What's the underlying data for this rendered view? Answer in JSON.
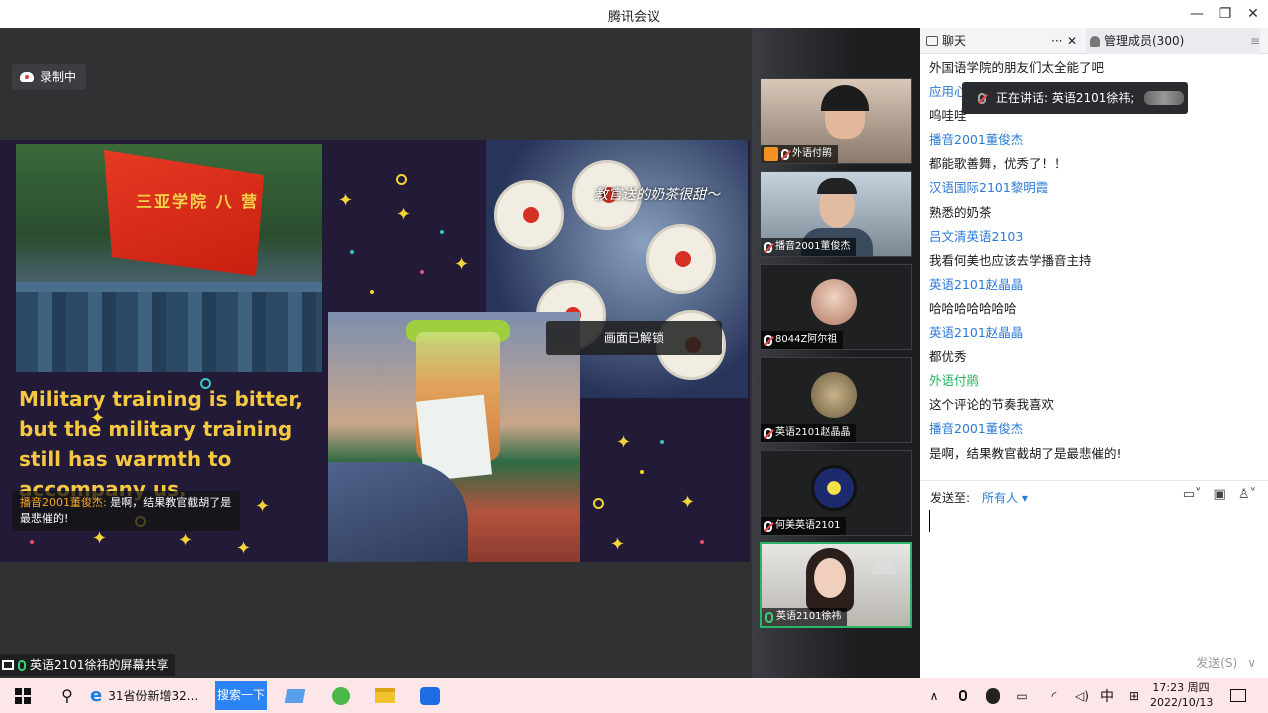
{
  "window": {
    "title": "腾讯会议",
    "minimize": "—",
    "maximize": "❐",
    "close": "✕"
  },
  "share": {
    "recording": "录制中",
    "slide_text": "Military training is  bitter, but the military training still has warmth to accompany us.",
    "flag_text": "三亚学院 八 营",
    "milk_caption": "教官送的奶茶很甜～",
    "unlock_notice": "画面已解锁",
    "subtitle_name": "播音2001董俊杰:",
    "subtitle_text": " 是啊，结果教官截胡了是最悲催的!",
    "share_label": "英语2101徐祎的屏幕共享"
  },
  "participants": [
    {
      "name": "外语付鹃",
      "role": "host",
      "mic": "muted"
    },
    {
      "name": "播音2001董俊杰",
      "mic": "muted"
    },
    {
      "name": "8044Z阿尔祖",
      "mic": "muted"
    },
    {
      "name": "英语2101赵晶晶",
      "mic": "muted"
    },
    {
      "name": "何美英语2101",
      "mic": "muted"
    },
    {
      "name": "英语2101徐祎",
      "mic": "on",
      "active": true
    }
  ],
  "chat": {
    "tab_chat": "聊天",
    "tab_more": "···",
    "tab_close": "✕",
    "tab_members": "管理成员(300)",
    "speaking": "正在讲话: 英语2101徐祎;",
    "messages": [
      {
        "type": "text",
        "value": "外国语学院的朋友们太全能了吧"
      },
      {
        "type": "name",
        "value": "应用心理2201郝弥"
      },
      {
        "type": "text",
        "value": "呜哇哇"
      },
      {
        "type": "name",
        "value": "播音2001董俊杰"
      },
      {
        "type": "text",
        "value": "都能歌善舞，优秀了！！"
      },
      {
        "type": "name",
        "value": "汉语国际2101黎明霞"
      },
      {
        "type": "text",
        "value": "熟悉的奶茶"
      },
      {
        "type": "name",
        "value": "吕文清英语2103"
      },
      {
        "type": "text",
        "value": "我看何美也应该去学播音主持"
      },
      {
        "type": "name",
        "value": "英语2101赵晶晶"
      },
      {
        "type": "text",
        "value": "哈哈哈哈哈哈哈"
      },
      {
        "type": "name",
        "value": "英语2101赵晶晶"
      },
      {
        "type": "text",
        "value": "都优秀"
      },
      {
        "type": "host",
        "value": "外语付鹃"
      },
      {
        "type": "text",
        "value": "这个评论的节奏我喜欢"
      },
      {
        "type": "name",
        "value": "播音2001董俊杰"
      },
      {
        "type": "text",
        "value": "是啊，结果教官截胡了是最悲催的!"
      }
    ],
    "send_to_label": "发送至:",
    "send_to_target": "所有人 ▾",
    "send_button": "发送(S)",
    "send_dropdown": "∨"
  },
  "taskbar": {
    "browser_tab": "31省份新增32...",
    "search_button": "搜索一下",
    "ime": "中",
    "time": "17:23 周四",
    "date": "2022/10/13"
  },
  "colors": {
    "accent_blue": "#2a7ad8",
    "host_green": "#21b35c",
    "slide_yellow": "#f5c842",
    "taskbar_pink": "#fde6e8"
  }
}
